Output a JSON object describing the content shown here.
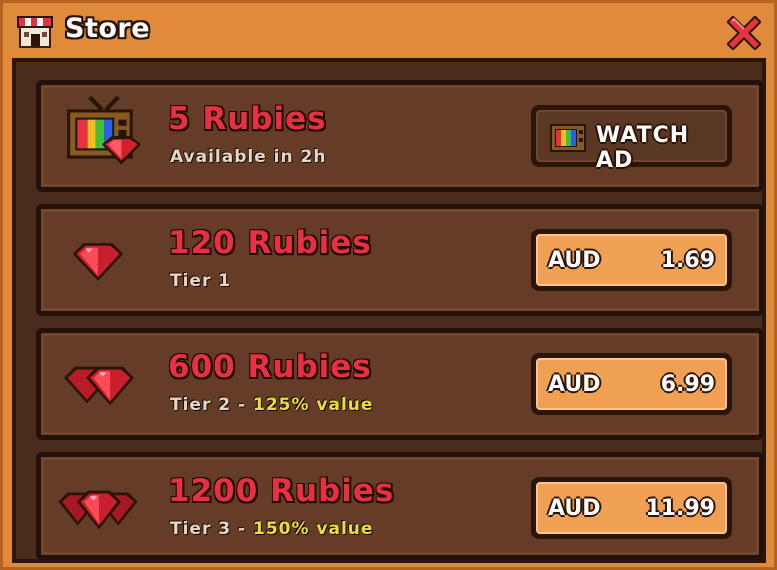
{
  "window": {
    "title": "Store"
  },
  "offers": [
    {
      "title": "5 Rubies",
      "subtitle": "Available in 2h",
      "subtitle_highlight": "",
      "icon": "tv-ruby-icon",
      "action": {
        "type": "watch_ad",
        "label": "WATCH AD"
      }
    },
    {
      "title": "120 Rubies",
      "subtitle": "Tier 1",
      "subtitle_highlight": "",
      "icon": "ruby-single-icon",
      "action": {
        "type": "buy",
        "currency": "AUD",
        "price": "1.69"
      }
    },
    {
      "title": "600 Rubies",
      "subtitle": "Tier 2 - ",
      "subtitle_highlight": "125% value",
      "icon": "ruby-double-icon",
      "action": {
        "type": "buy",
        "currency": "AUD",
        "price": "6.99"
      }
    },
    {
      "title": "1200 Rubies",
      "subtitle": "Tier 3 - ",
      "subtitle_highlight": "150% value",
      "icon": "ruby-triple-icon",
      "action": {
        "type": "buy",
        "currency": "AUD",
        "price": "11.99"
      }
    }
  ],
  "colors": {
    "frame": "#e08a3c",
    "panel": "#4a2c1c",
    "row": "#643c27",
    "ruby_text": "#e83040",
    "highlight": "#e6e03a",
    "price_button": "#f0a052"
  }
}
